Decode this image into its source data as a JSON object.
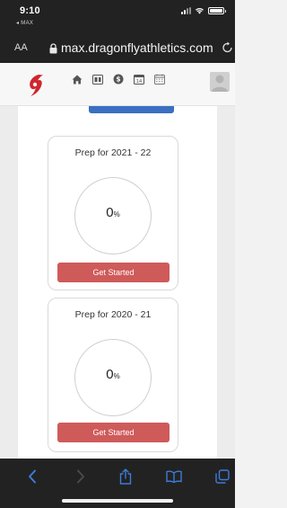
{
  "status_bar": {
    "time": "9:10",
    "back_app": "◂ MAX"
  },
  "browser": {
    "text_size_label": "AA",
    "url": "max.dragonflyathletics.com"
  },
  "site_nav": {
    "logo": "dragonfly-logo",
    "icons": [
      "home-icon",
      "scoreboard-icon",
      "money-icon",
      "calendar-day-icon",
      "calendar-icon"
    ]
  },
  "cards": [
    {
      "title": "Prep for 2021 - 22",
      "progress_value": "0",
      "progress_unit": "%",
      "button_label": "Get Started"
    },
    {
      "title": "Prep for 2020 - 21",
      "progress_value": "0",
      "progress_unit": "%",
      "button_label": "Get Started"
    }
  ],
  "colors": {
    "accent_blue": "#3a6fc2",
    "button_red": "#cf5a5a",
    "logo_red": "#d0262d",
    "toolbar_blue": "#3d7bd9"
  },
  "toolbar": {
    "icons": [
      "back-icon",
      "forward-icon",
      "share-icon",
      "bookmarks-icon",
      "tabs-icon"
    ]
  }
}
